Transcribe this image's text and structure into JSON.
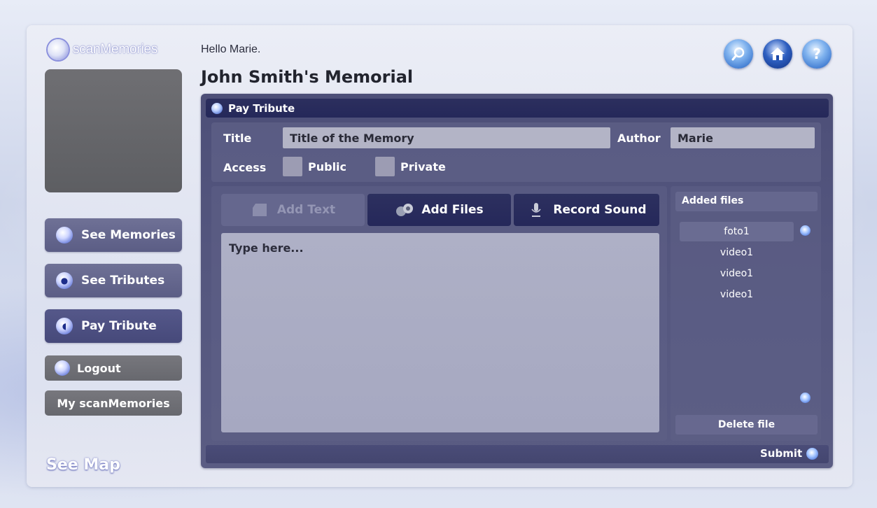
{
  "app": {
    "logo_text": "scanMemories"
  },
  "header": {
    "greeting": "Hello Marie.",
    "title": "John Smith's Memorial"
  },
  "sidebar": {
    "nav": [
      {
        "label": "See Memories",
        "icon": "globe-icon"
      },
      {
        "label": "See Tributes",
        "icon": "tributes-icon"
      },
      {
        "label": "Pay Tribute",
        "icon": "pay-tribute-icon"
      }
    ],
    "logout_label": "Logout",
    "my_label": "My scanMemories",
    "map_label": "See Map"
  },
  "top_icons": [
    "search-icon",
    "home-icon",
    "help-icon"
  ],
  "panel": {
    "title": "Pay Tribute",
    "form": {
      "title_label": "Title",
      "title_value": "Title of the Memory",
      "author_label": "Author",
      "author_value": "Marie",
      "access_label": "Access",
      "public_label": "Public",
      "private_label": "Private"
    },
    "tabs": [
      {
        "label": "Add Text",
        "state": "disabled"
      },
      {
        "label": "Add Files",
        "state": "active"
      },
      {
        "label": "Record Sound",
        "state": "active"
      }
    ],
    "editor_placeholder": "Type here...",
    "files": {
      "header": "Added files",
      "items": [
        "foto1",
        "video1",
        "video1",
        "video1"
      ],
      "delete_label": "Delete file"
    },
    "submit_label": "Submit"
  },
  "colors": {
    "accent": "#2a4ec0",
    "panel": "#4d4f78",
    "header": "#25285a"
  }
}
